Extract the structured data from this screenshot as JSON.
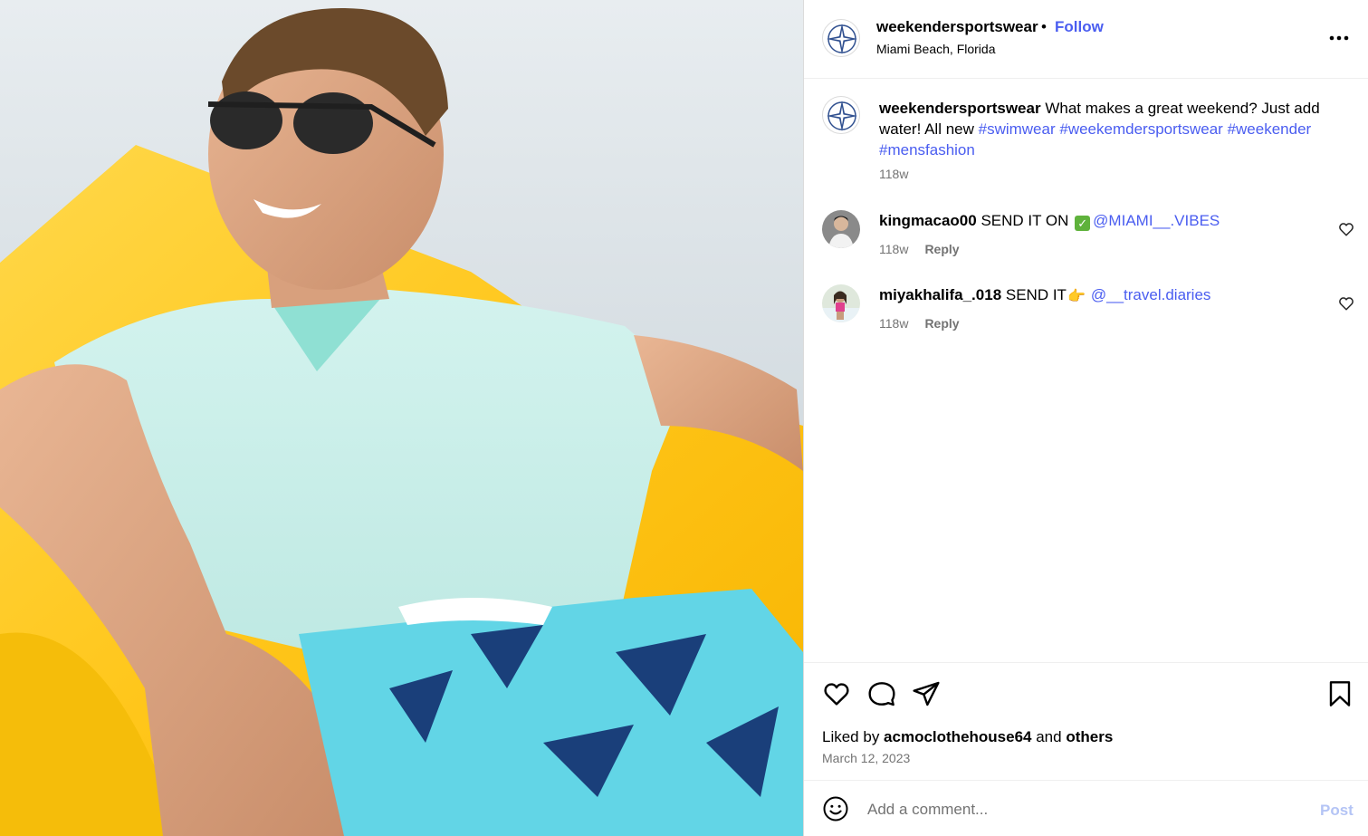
{
  "post": {
    "username": "weekendersportswear",
    "separator": "•",
    "follow_label": "Follow",
    "location": "Miami Beach, Florida",
    "more_icon": "more-horizontal-icon"
  },
  "caption": {
    "username": "weekendersportswear",
    "text": " What makes a great weekend? Just add water! All new ",
    "hashtags": [
      "#swimwear",
      "#weekemdersportswear",
      "#weekender",
      "#mensfashion"
    ],
    "time": "118w"
  },
  "comments": [
    {
      "username": "kingmacao00",
      "text": " SEND IT ON ",
      "emoji": "✓",
      "mention": "@MIAMI__.VIBES",
      "time": "118w",
      "reply_label": "Reply"
    },
    {
      "username": "miyakhalifa_.018",
      "text": " SEND IT",
      "emoji": "👉",
      "mention": "@__travel.diaries",
      "time": "118w",
      "reply_label": "Reply"
    }
  ],
  "actions": {
    "liked_prefix": "Liked by ",
    "liked_user": "acmoclothehouse64",
    "liked_mid": " and ",
    "liked_others": "others",
    "date": "March 12, 2023"
  },
  "add_comment": {
    "placeholder": "Add a comment...",
    "post_label": "Post"
  },
  "colors": {
    "link": "#4a5df0",
    "muted": "#737373",
    "post_disabled": "#b4c4f5"
  }
}
